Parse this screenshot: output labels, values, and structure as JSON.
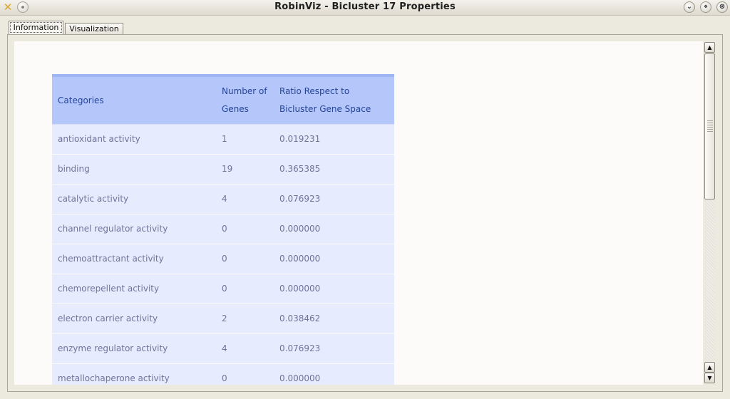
{
  "window": {
    "title": "RobinViz - Bicluster 17 Properties",
    "app_icon": "✕",
    "buttons": {
      "minimize": "⌄",
      "maximize": "⋄",
      "close": "⊗"
    }
  },
  "tabs": [
    {
      "label": "Information",
      "active": true
    },
    {
      "label": "Visualization",
      "active": false
    }
  ],
  "table": {
    "headers": {
      "categories": "Categories",
      "num_line1": "Number of",
      "num_line2": "Genes",
      "ratio_line1": "Ratio Respect to",
      "ratio_line2": "Bicluster Gene Space"
    },
    "rows": [
      {
        "category": "antioxidant activity",
        "genes": "1",
        "ratio": "0.019231"
      },
      {
        "category": "binding",
        "genes": "19",
        "ratio": "0.365385"
      },
      {
        "category": "catalytic activity",
        "genes": "4",
        "ratio": "0.076923"
      },
      {
        "category": "channel regulator activity",
        "genes": "0",
        "ratio": "0.000000"
      },
      {
        "category": "chemoattractant activity",
        "genes": "0",
        "ratio": "0.000000"
      },
      {
        "category": "chemorepellent activity",
        "genes": "0",
        "ratio": "0.000000"
      },
      {
        "category": "electron carrier activity",
        "genes": "2",
        "ratio": "0.038462"
      },
      {
        "category": "enzyme regulator activity",
        "genes": "4",
        "ratio": "0.076923"
      },
      {
        "category": "metallochaperone activity",
        "genes": "0",
        "ratio": "0.000000"
      }
    ]
  },
  "scrollbar": {
    "up_arrow": "▲",
    "down_arrow": "▼"
  },
  "colors": {
    "header_bg": "#b4c6fa",
    "header_text": "#254599",
    "row_bg": "#e6ecfd",
    "row_text": "#6f739a"
  }
}
